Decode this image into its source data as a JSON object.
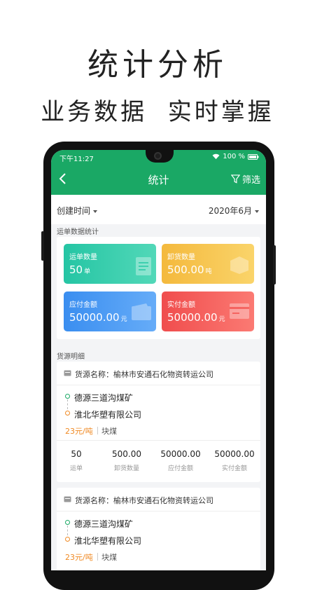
{
  "promo": {
    "title": "统计分析",
    "subtitle": "业务数据  实时掌握"
  },
  "status_bar": {
    "time": "下午11:27",
    "battery": "100 %"
  },
  "nav": {
    "title": "统计",
    "filter_label": "筛选"
  },
  "filter_row": {
    "left_label": "创建时间",
    "right_label": "2020年6月"
  },
  "stats": {
    "section_title": "运单数据统计",
    "cards": [
      {
        "label": "运单数量",
        "value": "50",
        "unit": "单",
        "icon": "clipboard-icon"
      },
      {
        "label": "卸货数量",
        "value": "500.00",
        "unit": "吨",
        "icon": "box-icon"
      },
      {
        "label": "应付金额",
        "value": "50000.00",
        "unit": "元",
        "icon": "wallet-icon"
      },
      {
        "label": "实付金额",
        "value": "50000.00",
        "unit": "元",
        "icon": "card-icon"
      }
    ]
  },
  "goods": {
    "section_title": "货源明细",
    "items": [
      {
        "name_label": "货源名称：",
        "name": "榆林市安通石化物资转运公司",
        "from": "德源三道沟煤矿",
        "to": "淮北华塑有限公司",
        "price": "23元/吨",
        "coal": "块煤",
        "metrics": [
          {
            "value": "50",
            "label": "运单"
          },
          {
            "value": "500.00",
            "label": "卸货数量"
          },
          {
            "value": "50000.00",
            "label": "应付金额"
          },
          {
            "value": "50000.00",
            "label": "实付金额"
          }
        ]
      },
      {
        "name_label": "货源名称：",
        "name": "榆林市安通石化物资转运公司",
        "from": "德源三道沟煤矿",
        "to": "淮北华塑有限公司",
        "price": "23元/吨",
        "coal": "块煤"
      }
    ]
  },
  "colors": {
    "primary": "#1aa865",
    "from_dot": "#1aa865",
    "to_dot": "#f08a24"
  }
}
